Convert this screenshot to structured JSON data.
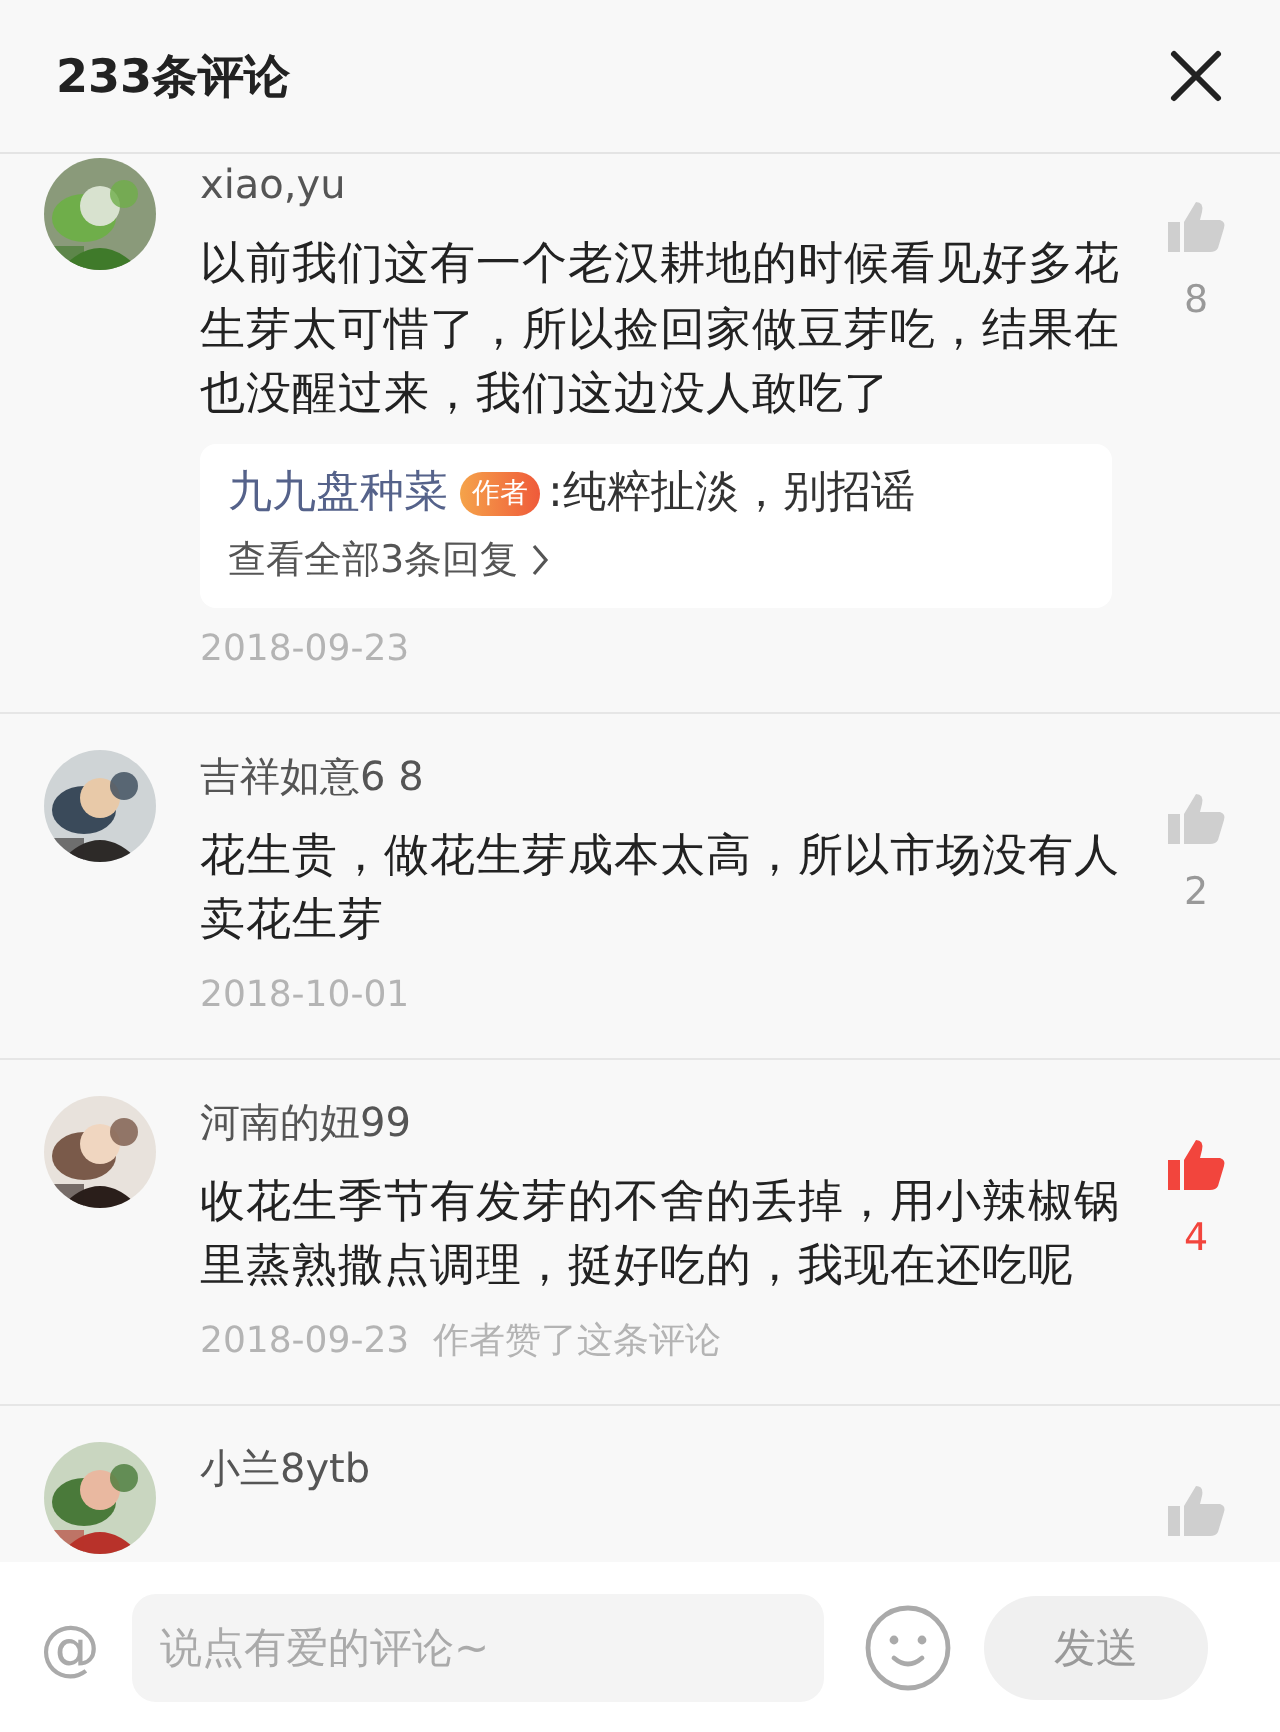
{
  "header": {
    "title": "233条评论"
  },
  "comments": [
    {
      "user": "xiao,yu",
      "text": "以前我们这有一个老汉耕地的时候看见好多花生芽太可惜了，所以捡回家做豆芽吃，结果在也没醒过来，我们这边没人敢吃了",
      "liked": false,
      "likes": "8",
      "reply": {
        "author": "九九盘种菜",
        "badge": "作者",
        "text": ":纯粹扯淡，别招谣",
        "more": "查看全部3条回复"
      },
      "date": "2018-09-23"
    },
    {
      "user": "吉祥如意6 8",
      "text": "花生贵，做花生芽成本太高，所以市场没有人卖花生芽",
      "liked": false,
      "likes": "2",
      "date": "2018-10-01"
    },
    {
      "user": "河南的妞99",
      "text": "收花生季节有发芽的不舍的丢掉，用小辣椒锅里蒸熟撒点调理，挺好吃的，我现在还吃呢",
      "liked": true,
      "likes": "4",
      "date": "2018-09-23",
      "note": "作者赞了这条评论"
    },
    {
      "user": "小兰8ytb",
      "liked": false
    }
  ],
  "composer": {
    "at": "@",
    "placeholder": "说点有爱的评论~",
    "send": "发送",
    "send_disabled": true
  }
}
